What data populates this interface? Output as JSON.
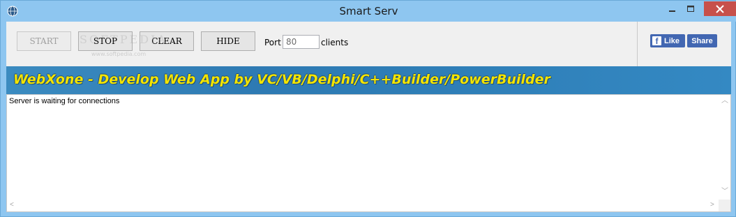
{
  "window": {
    "title": "Smart Serv",
    "icon": "globe-app-icon"
  },
  "toolbar": {
    "start_label": "START",
    "stop_label": "STOP",
    "clear_label": "CLEAR",
    "hide_label": "HIDE",
    "port_label": "Port",
    "port_value": "80",
    "clients_label": "clients"
  },
  "social": {
    "like_label": "Like",
    "share_label": "Share",
    "fb_icon": "facebook-icon",
    "brand_color": "#4267b2"
  },
  "watermark": {
    "text": "SOFTPEDIA",
    "url": "www.softpedia.com"
  },
  "banner": {
    "brand": "WebXone",
    "tagline": " - Develop Web App by VC/VB/Delphi/C++Builder/PowerBuilder"
  },
  "log": {
    "lines": [
      "Server is waiting for connections"
    ]
  },
  "colors": {
    "titlebar": "#8ec6f0",
    "close_button": "#c7504b",
    "banner_text": "#f3e400",
    "banner_bg": "#2e7ab3"
  }
}
